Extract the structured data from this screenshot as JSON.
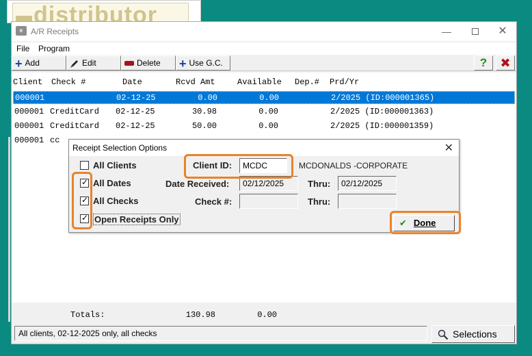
{
  "background_window": {
    "logo_text": "distributor"
  },
  "window": {
    "title": "A/R Receipts",
    "icon_text": "e",
    "minimize": "—",
    "close": "✕"
  },
  "menu": {
    "file": "File",
    "program": "Program"
  },
  "toolbar": {
    "add_label": "Add",
    "edit_label": "Edit",
    "delete_label": "Delete",
    "usegc_label": "Use G.C.",
    "help_label": "?",
    "exit_label": "✖"
  },
  "columns": {
    "client": "Client",
    "check": "Check #",
    "date": "Date",
    "rcvd_amt": "Rcvd Amt",
    "available": "Available",
    "dep": "Dep.#",
    "prd_yr": "Prd/Yr"
  },
  "rows": [
    {
      "client": "000001",
      "check": "",
      "date": "02-12-25",
      "rcvd": "0.00",
      "available": "0.00",
      "dep": "",
      "prd": "2/2025 (ID:000001365)"
    },
    {
      "client": "000001",
      "check": "CreditCard",
      "date": "02-12-25",
      "rcvd": "30.98",
      "available": "0.00",
      "dep": "",
      "prd": "2/2025 (ID:000001363)"
    },
    {
      "client": "000001",
      "check": "CreditCard",
      "date": "02-12-25",
      "rcvd": "50.00",
      "available": "0.00",
      "dep": "",
      "prd": "2/2025 (ID:000001359)"
    },
    {
      "client": "000001",
      "check": "cc",
      "date": "",
      "rcvd": "",
      "available": "",
      "dep": "",
      "prd": ""
    }
  ],
  "totals": {
    "label": "Totals:",
    "rcvd": "130.98",
    "available": "0.00"
  },
  "status": {
    "text": "All clients, 02-12-2025 only, all checks"
  },
  "selections_button": {
    "label": "Selections"
  },
  "dialog": {
    "title": "Receipt Selection Options",
    "close": "✕",
    "all_clients_label": "All Clients",
    "all_dates_label": "All Dates",
    "all_checks_label": "All Checks",
    "open_receipts_label": "Open Receipts Only",
    "all_clients_checked": false,
    "all_dates_checked": true,
    "all_checks_checked": true,
    "open_receipts_checked": true,
    "client_id_label": "Client ID:",
    "client_id_value": "MCDC",
    "client_name": "MCDONALDS -CORPORATE",
    "date_received_label": "Date Received:",
    "date_from": "02/12/2025",
    "thru_label": "Thru:",
    "date_thru": "02/12/2025",
    "check_label": "Check #:",
    "check_from": "",
    "check_thru": "",
    "done_label": "Done",
    "done_icon": "✔",
    "check_mark": "✓"
  },
  "colors": {
    "highlight": "#e8832b",
    "selected_row": "#0078d7",
    "desktop": "#0a8a80"
  }
}
